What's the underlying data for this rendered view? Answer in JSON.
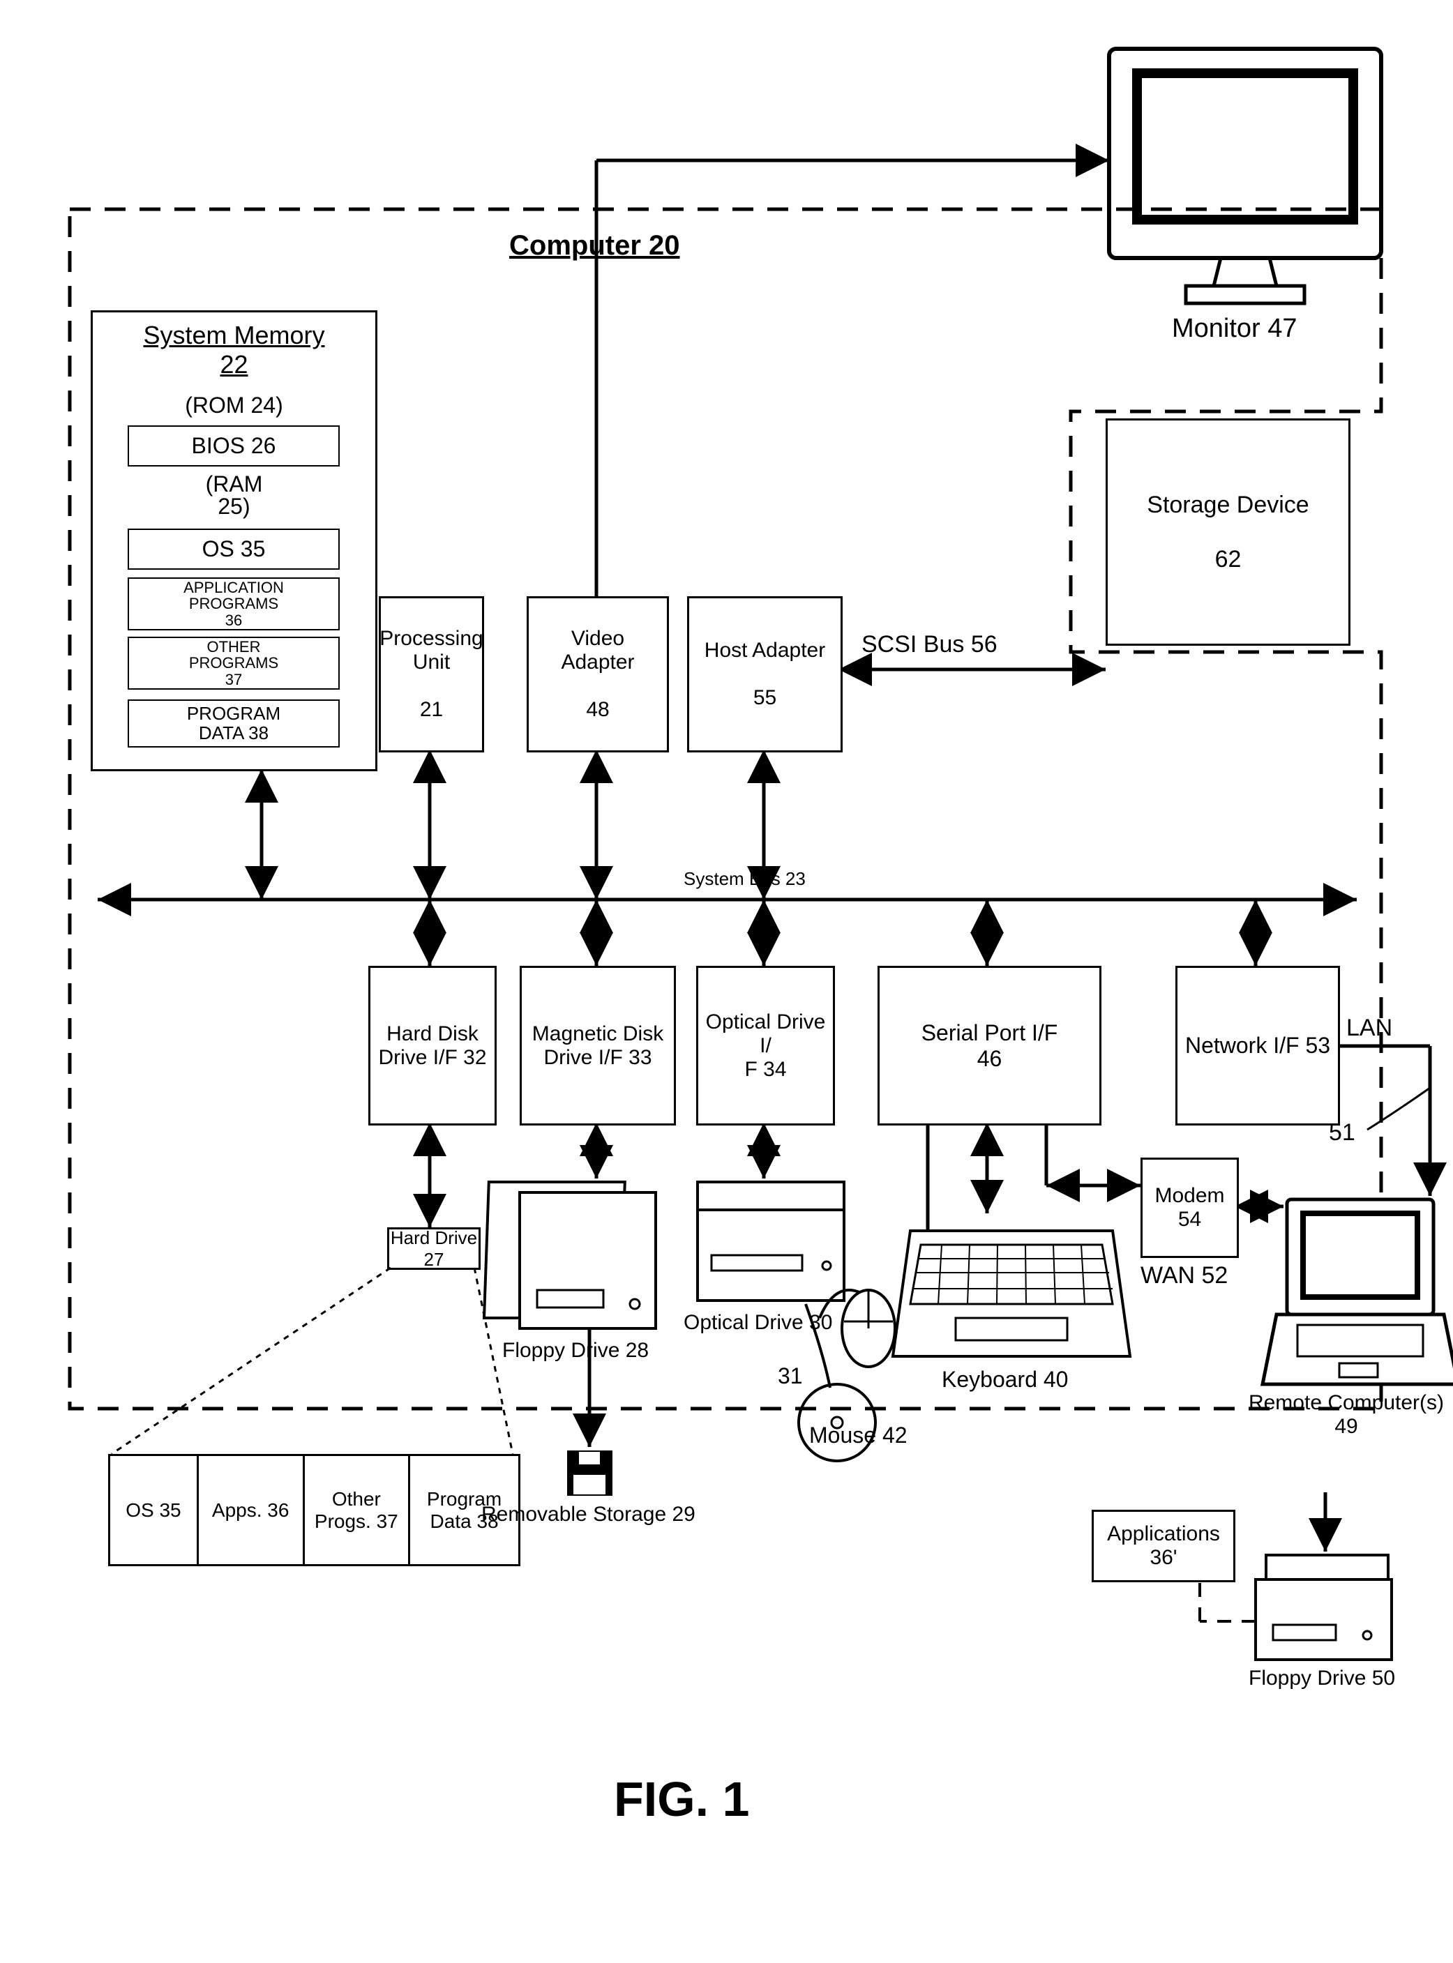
{
  "fig": "FIG. 1",
  "computer": "Computer 20",
  "sysmem": {
    "title": "System Memory",
    "num": "22",
    "rom": "(ROM 24)",
    "bios": "BIOS 26",
    "ram": "(RAM 25)",
    "os": "OS 35",
    "app": "APPLICATION PROGRAMS 36",
    "other": "OTHER PROGRAMS 37",
    "data": "PROGRAM DATA 38"
  },
  "proc": "Processing Unit\n21",
  "video": "Video Adapter\n48",
  "host": "Host Adapter\n55",
  "scsi": "SCSI Bus 56",
  "storage": "Storage Device\n62",
  "monitor": "Monitor 47",
  "sysbus": "System Bus 23",
  "hdif": "Hard Disk Drive I/F 32",
  "mdif": "Magnetic Disk Drive I/F 33",
  "odif": "Optical Drive I/F 34",
  "spif": "Serial Port I/F\n46",
  "netif": "Network I/F 53",
  "hd": "Hard Drive 27",
  "floppy28": "Floppy Drive 28",
  "removable": "Removable Storage 29",
  "optical30": "Optical Drive 30",
  "cd31": "31",
  "mouse": "Mouse 42",
  "keyboard": "Keyboard 40",
  "modem": "Modem\n54",
  "wan": "WAN 52",
  "lan": "LAN",
  "lan_num": "51",
  "remote": "Remote Computer(s)\n49",
  "floppy50": "Floppy Drive 50",
  "apps36p": "Applications\n36'",
  "hdcontents": {
    "os": "OS 35",
    "apps": "Apps. 36",
    "other": "Other Progs. 37",
    "data": "Program Data 38"
  }
}
